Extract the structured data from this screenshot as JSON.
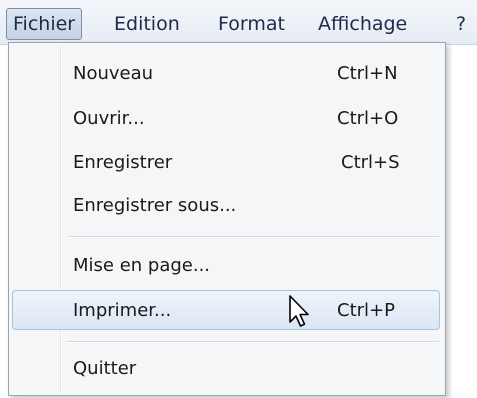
{
  "menubar": {
    "items": [
      {
        "label": "Fichier"
      },
      {
        "label": "Edition"
      },
      {
        "label": "Format"
      },
      {
        "label": "Affichage"
      },
      {
        "label": "?"
      }
    ]
  },
  "menu": {
    "items": [
      {
        "label": "Nouveau",
        "shortcut": "Ctrl+N"
      },
      {
        "label": "Ouvrir...",
        "shortcut": "Ctrl+O"
      },
      {
        "label": "Enregistrer",
        "shortcut": "Ctrl+S"
      },
      {
        "label": "Enregistrer sous...",
        "shortcut": ""
      },
      {
        "label": "Mise en page...",
        "shortcut": ""
      },
      {
        "label": "Imprimer...",
        "shortcut": "Ctrl+P"
      },
      {
        "label": "Quitter",
        "shortcut": ""
      }
    ],
    "highlighted": "Imprimer...",
    "pointer_icon": "arrow-cursor-icon"
  },
  "colors": {
    "highlight_border": "#a9c3de",
    "highlight_fill": "#dbe6f3",
    "menubar_active": "#c5d2e3",
    "text": "#1a1a1a"
  }
}
